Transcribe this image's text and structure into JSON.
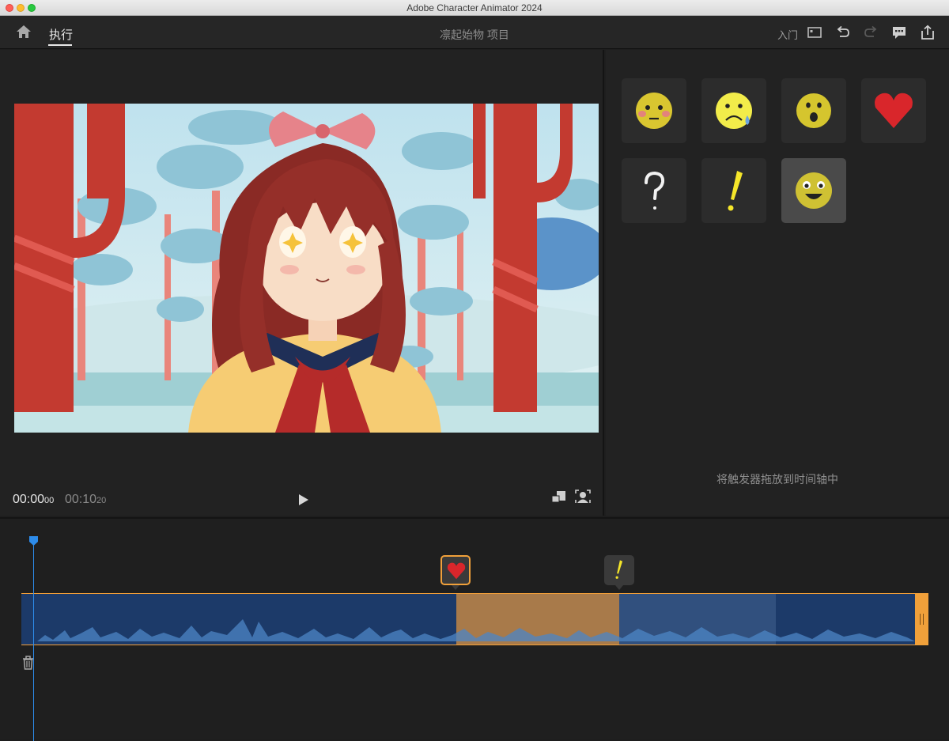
{
  "window": {
    "title": "Adobe Character Animator 2024"
  },
  "header": {
    "tab_perform": "执行",
    "project_title": "凛起始物 项目",
    "link_getting_started": "入门"
  },
  "stage": {
    "time_current": "00:00",
    "time_current_frames": "00",
    "time_total": "00:10",
    "time_total_frames": "20"
  },
  "triggers": {
    "items": [
      {
        "name": "embarrassed-face",
        "selected": false
      },
      {
        "name": "sad-face",
        "selected": false
      },
      {
        "name": "surprised-face",
        "selected": false
      },
      {
        "name": "heart",
        "selected": false
      },
      {
        "name": "question-mark",
        "selected": false
      },
      {
        "name": "exclamation-mark",
        "selected": false
      },
      {
        "name": "happy-face",
        "selected": true
      }
    ],
    "drop_hint": "将触发器拖放到时间轴中"
  },
  "timeline": {
    "playhead_time": "00:00",
    "markers": [
      {
        "name": "heart",
        "highlighted": true
      },
      {
        "name": "exclamation-mark",
        "highlighted": false
      }
    ]
  },
  "colors": {
    "accent_orange": "#f0a03a",
    "track_blue": "#1c3a69",
    "playhead_blue": "#2d8ceb"
  }
}
